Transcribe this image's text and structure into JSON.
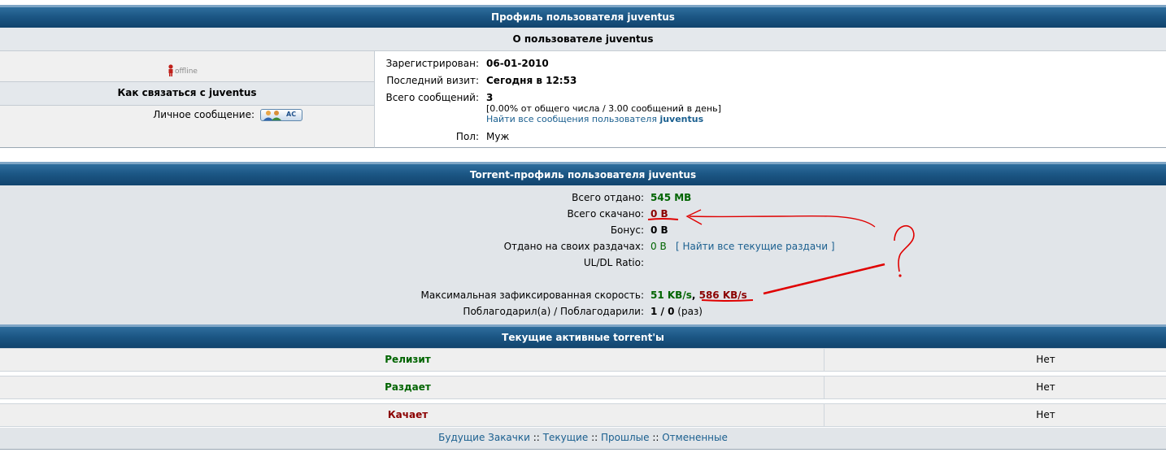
{
  "profile": {
    "title": "Профиль пользователя juventus",
    "about_title": "О пользователе juventus",
    "status": "offline",
    "contact_title": "Как связаться с juventus",
    "pm_label": "Личное сообщение:",
    "pm_button_text": "AC",
    "registered_label": "Зарегистрирован:",
    "registered_value": "06-01-2010",
    "last_visit_label": "Последний визит:",
    "last_visit_value": "Сегодня в 12:53",
    "posts_label": "Всего сообщений:",
    "posts_value": "3",
    "posts_stats": "[0.00% от общего числа / 3.00 сообщений в день]",
    "posts_link_prefix": "Найти все сообщения пользователя",
    "posts_link_user": "juventus",
    "gender_label": "Пол:",
    "gender_value": "Муж"
  },
  "torrent": {
    "title": "Torrent-профиль пользователя juventus",
    "uploaded_label": "Всего отдано:",
    "uploaded_value": "545 MB",
    "downloaded_label": "Всего скачано:",
    "downloaded_value": "0 B",
    "bonus_label": "Бонус:",
    "bonus_value": "0 B",
    "own_label": "Отдано на своих раздачах:",
    "own_value": "0 B",
    "own_link": "[ Найти все текущие раздачи ]",
    "ratio_label": "UL/DL Ratio:",
    "speed_label": "Максимальная зафиксированная скорость:",
    "speed_up": "51 KB/s",
    "speed_sep": ",",
    "speed_down": "586 KB/s",
    "thanks_label": "Поблагодарил(а) / Поблагодарили:",
    "thanks_value": "1 / 0",
    "thanks_unit": "(раз)"
  },
  "active": {
    "title": "Текущие активные torrent'ы",
    "rows": [
      {
        "label": "Релизит",
        "value": "Нет",
        "color": "#006400"
      },
      {
        "label": "Раздает",
        "value": "Нет",
        "color": "#006400"
      },
      {
        "label": "Качает",
        "value": "Нет",
        "color": "#8b0000"
      }
    ]
  },
  "footer_links": {
    "future": "Будущие Закачки",
    "current": "Текущие",
    "past": "Прошлые",
    "cancelled": "Отмененные",
    "sep": "::"
  },
  "annotation": {
    "mark": "?",
    "color": "#e00000"
  }
}
